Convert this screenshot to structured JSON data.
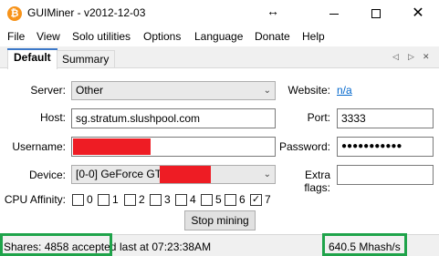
{
  "window": {
    "title": "GUIMiner - v2012-12-03",
    "app_icon_glyph": "₿",
    "resize_glyph": "↔",
    "close_glyph": "✕"
  },
  "menu": [
    "File",
    "View",
    "Solo utilities",
    "Options",
    "Language",
    "Donate",
    "Help"
  ],
  "tabs": [
    {
      "label": "Default",
      "active": true
    },
    {
      "label": "Summary",
      "active": false
    }
  ],
  "tab_nav": {
    "prev": "◁",
    "next": "▷",
    "close": "✕"
  },
  "form": {
    "server_label": "Server:",
    "server_value": "Other",
    "website_label": "Website:",
    "website_link": "n/a",
    "host_label": "Host:",
    "host_value": "sg.stratum.slushpool.com",
    "port_label": "Port:",
    "port_value": "3333",
    "username_label": "Username:",
    "username_value": "",
    "password_label": "Password:",
    "password_value": "●●●●●●●●●●●",
    "device_label": "Device:",
    "device_value": "[0-0] GeForce GTX",
    "extra_flags_label": "Extra flags:",
    "extra_flags_value": "",
    "cpu_affinity_label": "CPU Affinity:",
    "cpu_affinity": [
      {
        "label": "0",
        "checked": false
      },
      {
        "label": "1",
        "checked": false
      },
      {
        "label": "2",
        "checked": false
      },
      {
        "label": "3",
        "checked": false
      },
      {
        "label": "4",
        "checked": false
      },
      {
        "label": "5",
        "checked": false
      },
      {
        "label": "6",
        "checked": false
      },
      {
        "label": "7",
        "checked": true
      }
    ],
    "stop_button": "Stop mining"
  },
  "status": {
    "shares": "Shares: 4858 accepted",
    "last_at": "last at 07:23:38AM",
    "hashrate": "640.5 Mhash/s"
  },
  "colors": {
    "redaction": "#ee1c24",
    "highlight": "#1fa34a",
    "link": "#0066cc",
    "app_icon": "#f7931a"
  }
}
